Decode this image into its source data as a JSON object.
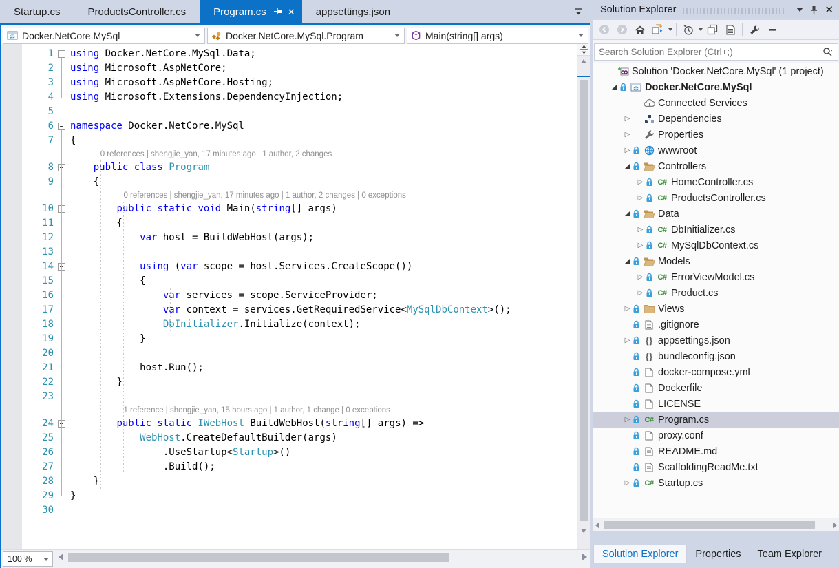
{
  "colors": {
    "accent_blue": "#0C72C8",
    "keyword_blue": "#0000FF",
    "type_teal": "#2B91AF",
    "chrome": "#CFD6E5",
    "selection_gray": "#CCCEDB",
    "folder_tan": "#DCB67A",
    "csharp_green": "#388A34",
    "lock_blue": "#3AA0DC",
    "solution_purple": "#68217A"
  },
  "editor_tabs": {
    "tabs": [
      {
        "label": "Startup.cs",
        "active": false
      },
      {
        "label": "ProductsController.cs",
        "active": false
      },
      {
        "label": "Program.cs",
        "active": true
      },
      {
        "label": "appsettings.json",
        "active": false
      }
    ],
    "tab_list_icon": "chevron-with-bar"
  },
  "navbar": {
    "project": "Docker.NetCore.MySql",
    "type": "Docker.NetCore.MySql.Program",
    "member": "Main(string[] args)"
  },
  "editor": {
    "zoom_value": "100 %",
    "lines": [
      {
        "f": 1,
        "t": [
          [
            "k",
            "using"
          ],
          [
            "p",
            " Docker.NetCore.MySql.Data;"
          ]
        ]
      },
      {
        "t": [
          [
            "k",
            "using"
          ],
          [
            "p",
            " Microsoft.AspNetCore;"
          ]
        ]
      },
      {
        "t": [
          [
            "k",
            "using"
          ],
          [
            "p",
            " Microsoft.AspNetCore.Hosting;"
          ]
        ]
      },
      {
        "t": [
          [
            "k",
            "using"
          ],
          [
            "p",
            " Microsoft.Extensions.DependencyInjection;"
          ]
        ]
      },
      {
        "t": []
      },
      {
        "f": 1,
        "t": [
          [
            "k",
            "namespace"
          ],
          [
            "p",
            " Docker.NetCore.MySql"
          ]
        ]
      },
      {
        "t": [
          [
            "p",
            "{"
          ]
        ]
      },
      {
        "f": 1,
        "cl": {
          "text": "0 references | shengjie_yan, 17 minutes ago | 1 author, 2 changes",
          "ind": 4
        },
        "t": [
          [
            "p",
            "    "
          ],
          [
            "k",
            "public"
          ],
          [
            "p",
            " "
          ],
          [
            "k",
            "class"
          ],
          [
            "p",
            " "
          ],
          [
            "y",
            "Program"
          ]
        ]
      },
      {
        "t": [
          [
            "p",
            "    {"
          ]
        ]
      },
      {
        "f": 1,
        "cl": {
          "text": "0 references | shengjie_yan, 17 minutes ago | 1 author, 2 changes | 0 exceptions",
          "ind": 8
        },
        "t": [
          [
            "p",
            "        "
          ],
          [
            "k",
            "public"
          ],
          [
            "p",
            " "
          ],
          [
            "k",
            "static"
          ],
          [
            "p",
            " "
          ],
          [
            "k",
            "void"
          ],
          [
            "p",
            " Main("
          ],
          [
            "k",
            "string"
          ],
          [
            "p",
            "[] args)"
          ]
        ]
      },
      {
        "t": [
          [
            "p",
            "        {"
          ]
        ]
      },
      {
        "t": [
          [
            "p",
            "            "
          ],
          [
            "k",
            "var"
          ],
          [
            "p",
            " host = BuildWebHost(args);"
          ]
        ]
      },
      {
        "t": []
      },
      {
        "f": 1,
        "t": [
          [
            "p",
            "            "
          ],
          [
            "k",
            "using"
          ],
          [
            "p",
            " ("
          ],
          [
            "k",
            "var"
          ],
          [
            "p",
            " scope = host.Services.CreateScope())"
          ]
        ]
      },
      {
        "t": [
          [
            "p",
            "            {"
          ]
        ]
      },
      {
        "t": [
          [
            "p",
            "                "
          ],
          [
            "k",
            "var"
          ],
          [
            "p",
            " services = scope.ServiceProvider;"
          ]
        ]
      },
      {
        "t": [
          [
            "p",
            "                "
          ],
          [
            "k",
            "var"
          ],
          [
            "p",
            " context = services.GetRequiredService<"
          ],
          [
            "y",
            "MySqlDbContext"
          ],
          [
            "p",
            ">();"
          ]
        ]
      },
      {
        "t": [
          [
            "p",
            "                "
          ],
          [
            "y",
            "DbInitializer"
          ],
          [
            "p",
            ".Initialize(context);"
          ]
        ]
      },
      {
        "t": [
          [
            "p",
            "            }"
          ]
        ]
      },
      {
        "t": []
      },
      {
        "t": [
          [
            "p",
            "            host.Run();"
          ]
        ]
      },
      {
        "t": [
          [
            "p",
            "        }"
          ]
        ]
      },
      {
        "t": []
      },
      {
        "f": 1,
        "cl": {
          "text": "1 reference | shengjie_yan, 15 hours ago | 1 author, 1 change | 0 exceptions",
          "ind": 8
        },
        "t": [
          [
            "p",
            "        "
          ],
          [
            "k",
            "public"
          ],
          [
            "p",
            " "
          ],
          [
            "k",
            "static"
          ],
          [
            "p",
            " "
          ],
          [
            "y",
            "IWebHost"
          ],
          [
            "p",
            " BuildWebHost("
          ],
          [
            "k",
            "string"
          ],
          [
            "p",
            "[] args) =>"
          ]
        ]
      },
      {
        "t": [
          [
            "p",
            "            "
          ],
          [
            "y",
            "WebHost"
          ],
          [
            "p",
            ".CreateDefaultBuilder(args)"
          ]
        ]
      },
      {
        "t": [
          [
            "p",
            "                .UseStartup<"
          ],
          [
            "y",
            "Startup"
          ],
          [
            "p",
            ">()"
          ]
        ]
      },
      {
        "t": [
          [
            "p",
            "                .Build();"
          ]
        ]
      },
      {
        "t": [
          [
            "p",
            "    }"
          ]
        ]
      },
      {
        "t": [
          [
            "p",
            "}"
          ]
        ]
      },
      {
        "t": []
      }
    ]
  },
  "solution_explorer": {
    "title": "Solution Explorer",
    "toolbar": [
      "back",
      "forward",
      "home",
      "switch-views",
      "sep",
      "pending-changes-filter",
      "sync-with-active-document",
      "preview-selected-items",
      "sep",
      "properties",
      "collapse-all"
    ],
    "search_placeholder": "Search Solution Explorer (Ctrl+;)",
    "items": [
      {
        "label": "Solution 'Docker.NetCore.MySql' (1 project)",
        "depth": 0,
        "icon": "solution",
        "arrow": "none",
        "plus": true
      },
      {
        "label": "Docker.NetCore.MySql",
        "depth": 1,
        "icon": "project",
        "arrow": "exp",
        "lock": true,
        "bold": true
      },
      {
        "label": "Connected Services",
        "depth": 2,
        "icon": "cloud",
        "arrow": "none"
      },
      {
        "label": "Dependencies",
        "depth": 2,
        "icon": "deps",
        "arrow": "col"
      },
      {
        "label": "Properties",
        "depth": 2,
        "icon": "wrench",
        "arrow": "col"
      },
      {
        "label": "wwwroot",
        "depth": 2,
        "icon": "globe",
        "arrow": "col",
        "lock": true
      },
      {
        "label": "Controllers",
        "depth": 2,
        "icon": "folder-open",
        "arrow": "exp",
        "lock": true
      },
      {
        "label": "HomeController.cs",
        "depth": 3,
        "icon": "cs",
        "arrow": "col",
        "lock": true
      },
      {
        "label": "ProductsController.cs",
        "depth": 3,
        "icon": "cs",
        "arrow": "col",
        "lock": true
      },
      {
        "label": "Data",
        "depth": 2,
        "icon": "folder-open",
        "arrow": "exp",
        "lock": true
      },
      {
        "label": "DbInitializer.cs",
        "depth": 3,
        "icon": "cs",
        "arrow": "col",
        "lock": true
      },
      {
        "label": "MySqlDbContext.cs",
        "depth": 3,
        "icon": "cs",
        "arrow": "col",
        "lock": true
      },
      {
        "label": "Models",
        "depth": 2,
        "icon": "folder-open",
        "arrow": "exp",
        "lock": true
      },
      {
        "label": "ErrorViewModel.cs",
        "depth": 3,
        "icon": "cs",
        "arrow": "col",
        "lock": true
      },
      {
        "label": "Product.cs",
        "depth": 3,
        "icon": "cs",
        "arrow": "col",
        "lock": true
      },
      {
        "label": "Views",
        "depth": 2,
        "icon": "folder",
        "arrow": "col",
        "lock": true
      },
      {
        "label": ".gitignore",
        "depth": 2,
        "icon": "doc",
        "arrow": "none",
        "lock": true
      },
      {
        "label": "appsettings.json",
        "depth": 2,
        "icon": "json",
        "arrow": "col",
        "lock": true
      },
      {
        "label": "bundleconfig.json",
        "depth": 2,
        "icon": "json",
        "arrow": "none",
        "lock": true
      },
      {
        "label": "docker-compose.yml",
        "depth": 2,
        "icon": "file",
        "arrow": "none",
        "lock": true
      },
      {
        "label": "Dockerfile",
        "depth": 2,
        "icon": "file",
        "arrow": "none",
        "lock": true
      },
      {
        "label": "LICENSE",
        "depth": 2,
        "icon": "file",
        "arrow": "none",
        "lock": true
      },
      {
        "label": "Program.cs",
        "depth": 2,
        "icon": "cs",
        "arrow": "col",
        "lock": true,
        "selected": true
      },
      {
        "label": "proxy.conf",
        "depth": 2,
        "icon": "file",
        "arrow": "none",
        "lock": true
      },
      {
        "label": "README.md",
        "depth": 2,
        "icon": "doc",
        "arrow": "none",
        "lock": true
      },
      {
        "label": "ScaffoldingReadMe.txt",
        "depth": 2,
        "icon": "doc",
        "arrow": "none",
        "lock": true
      },
      {
        "label": "Startup.cs",
        "depth": 2,
        "icon": "cs",
        "arrow": "col",
        "lock": true
      }
    ],
    "bottom_tabs": [
      {
        "label": "Solution Explorer",
        "active": true
      },
      {
        "label": "Properties",
        "active": false
      },
      {
        "label": "Team Explorer",
        "active": false
      }
    ]
  }
}
